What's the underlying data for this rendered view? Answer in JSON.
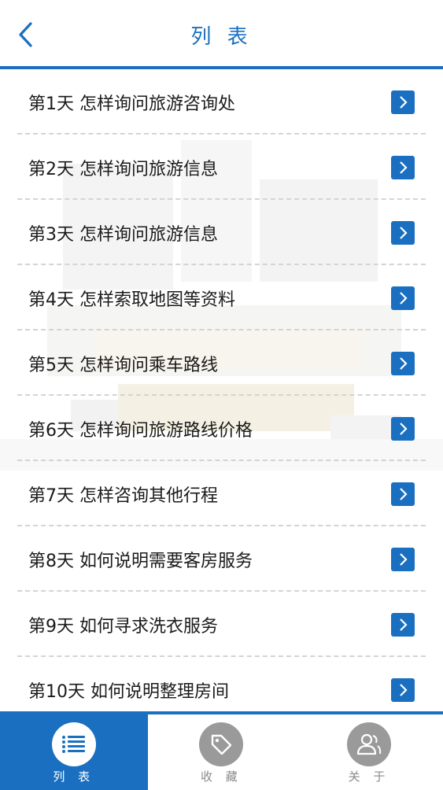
{
  "header": {
    "title": "列 表"
  },
  "colors": {
    "accent": "#1a6fc0",
    "divider": "#d4d4d4",
    "inactive": "#9a9a9a"
  },
  "list": {
    "items": [
      {
        "label": "第1天  怎样询问旅游咨询处"
      },
      {
        "label": "第2天  怎样询问旅游信息"
      },
      {
        "label": "第3天  怎样询问旅游信息"
      },
      {
        "label": "第4天  怎样索取地图等资料"
      },
      {
        "label": "第5天  怎样询问乘车路线"
      },
      {
        "label": "第6天  怎样询问旅游路线价格"
      },
      {
        "label": "第7天  怎样咨询其他行程"
      },
      {
        "label": "第8天  如何说明需要客房服务"
      },
      {
        "label": "第9天  如何寻求洗衣服务"
      },
      {
        "label": "第10天  如何说明整理房间"
      }
    ]
  },
  "tabs": [
    {
      "label": "列 表",
      "icon": "list-icon",
      "active": true
    },
    {
      "label": "收 藏",
      "icon": "tag-icon",
      "active": false
    },
    {
      "label": "关 于",
      "icon": "user-icon",
      "active": false
    }
  ]
}
